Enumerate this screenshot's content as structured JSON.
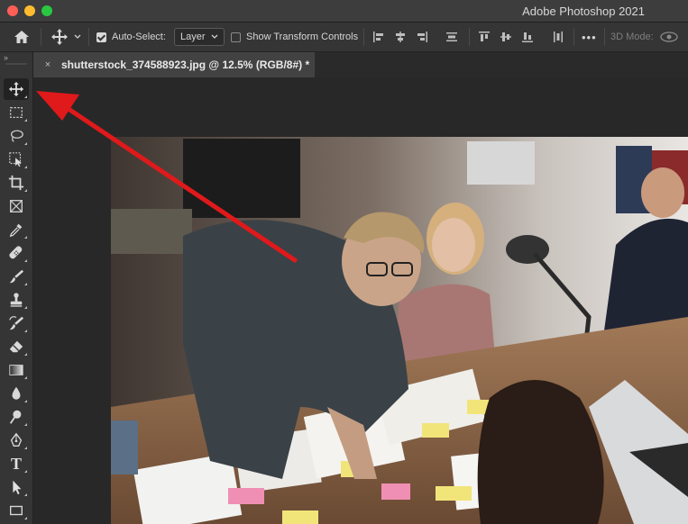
{
  "window": {
    "title": "Adobe Photoshop 2021"
  },
  "options_bar": {
    "auto_select_label": "Auto-Select:",
    "auto_select_checked": true,
    "auto_select_value": "Layer",
    "show_transform_label": "Show Transform Controls",
    "show_transform_checked": false,
    "mode_3d_label": "3D Mode:",
    "more_label": "•••"
  },
  "document_tab": {
    "close_glyph": "×",
    "label": "shutterstock_374588923.jpg @ 12.5% (RGB/8#) *"
  },
  "toolbar": {
    "grip": "››",
    "tools": [
      {
        "name": "move-tool",
        "icon": "move-icon",
        "active": true
      },
      {
        "name": "rectangular-marquee-tool",
        "icon": "marquee-icon",
        "active": false
      },
      {
        "name": "lasso-tool",
        "icon": "lasso-icon",
        "active": false
      },
      {
        "name": "object-selection-tool",
        "icon": "object-selection-icon",
        "active": false
      },
      {
        "name": "crop-tool",
        "icon": "crop-icon",
        "active": false
      },
      {
        "name": "frame-tool",
        "icon": "frame-icon",
        "active": false
      },
      {
        "name": "eyedropper-tool",
        "icon": "eyedropper-icon",
        "active": false
      },
      {
        "name": "spot-healing-brush-tool",
        "icon": "healing-icon",
        "active": false
      },
      {
        "name": "brush-tool",
        "icon": "brush-icon",
        "active": false
      },
      {
        "name": "clone-stamp-tool",
        "icon": "stamp-icon",
        "active": false
      },
      {
        "name": "history-brush-tool",
        "icon": "history-brush-icon",
        "active": false
      },
      {
        "name": "eraser-tool",
        "icon": "eraser-icon",
        "active": false
      },
      {
        "name": "gradient-tool",
        "icon": "gradient-icon",
        "active": false
      },
      {
        "name": "blur-tool",
        "icon": "blur-icon",
        "active": false
      },
      {
        "name": "dodge-tool",
        "icon": "dodge-icon",
        "active": false
      },
      {
        "name": "pen-tool",
        "icon": "pen-icon",
        "active": false
      },
      {
        "name": "type-tool",
        "icon": "type-icon",
        "active": false,
        "glyph": "T"
      },
      {
        "name": "path-selection-tool",
        "icon": "path-selection-icon",
        "active": false
      },
      {
        "name": "rectangle-tool",
        "icon": "rectangle-icon",
        "active": false
      }
    ]
  },
  "annotation": {
    "arrow_color": "#e0191b",
    "points_to": "move-tool"
  },
  "colors": {
    "titlebar": "#3d3d3d",
    "panel": "#353535",
    "workspace": "#282828",
    "tab_active": "#424242"
  }
}
